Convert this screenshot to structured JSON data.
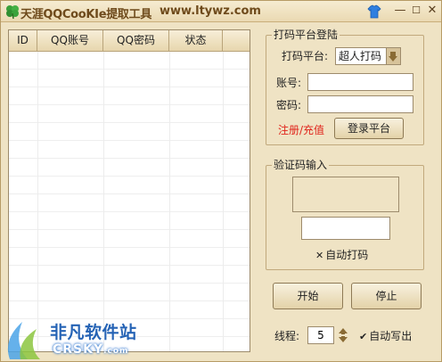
{
  "titlebar": {
    "app_title": "天涯QQCooKIe提取工具",
    "url": "www.ltywz.com",
    "icons": [
      "clover-icon",
      "shirt-icon",
      "minimize-icon",
      "maximize-icon",
      "close-icon"
    ],
    "minimize_glyph": "—",
    "maximize_glyph": "☐",
    "close_glyph": "✕"
  },
  "table": {
    "columns": [
      "ID",
      "QQ账号",
      "QQ密码",
      "状态",
      ""
    ],
    "rows": []
  },
  "login_group": {
    "title": "打码平台登陆",
    "platform_label": "打码平台:",
    "platform_selected": "超人打码",
    "account_label": "账号:",
    "account_value": "",
    "password_label": "密码:",
    "password_value": "",
    "register_link": "注册/充值",
    "login_button": "登录平台"
  },
  "captcha_group": {
    "title": "验证码输入",
    "code_value": "",
    "auto_code_label": "自动打码",
    "auto_code_checked": false
  },
  "actions": {
    "start_button": "开始",
    "stop_button": "停止",
    "threads_label": "线程:",
    "threads_value": "5",
    "auto_write_label": "自动写出",
    "auto_write_checked": true
  },
  "watermark": {
    "text": "非凡软件站",
    "sub": "CRSKY",
    "sub_suffix": ".com"
  },
  "colors": {
    "background": "#efe3c4",
    "accent_red": "#e0241b",
    "watermark_blue": "#2563b5"
  }
}
